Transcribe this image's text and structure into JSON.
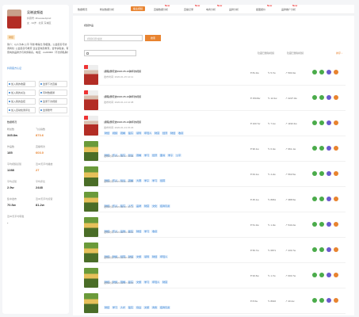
{
  "profile": {
    "name": "吴晓波频道",
    "id": "抖音号: Zhaoxiaobpind",
    "meta": "女  · 34岁 · 北京 东城区",
    "tag": "财经",
    "bio": "简介：以人为本,公平 平衡 唯得比 到极致。公益慈善与协调商化: 公益慈善与教育 企业咨询及教育。合作请私信，有意向的品牌方与商务联系。电话：xxx00000（不支持私聊）",
    "verified": "抖音官方认证"
  },
  "side_buttons": [
    "加入我的收藏",
    "监测下次直播",
    "加入我的关注",
    "同时数据通",
    "加入我的监控",
    "监测下次视频",
    "加入自动检测评论",
    "监测账号"
  ],
  "stats_title": "数据概况",
  "stats": [
    {
      "label": "粉丝数",
      "value": "345.8w",
      "orange": false
    },
    {
      "label": "飞瓜指数",
      "value": "873.6",
      "orange": true
    },
    {
      "label": "作品数",
      "value": "185",
      "orange": false
    },
    {
      "label": "直播场次",
      "value": "603.0",
      "orange": true
    },
    {
      "label": "平均视频点赞",
      "value": "1288",
      "orange": false
    },
    {
      "label": "近30天平均播放",
      "value": "27",
      "orange": true
    },
    {
      "label": "平均点赞",
      "value": "2.9w",
      "orange": false
    },
    {
      "label": "平均评论",
      "value": "2448",
      "orange": false
    },
    {
      "label": "集中发布",
      "value": "70.5w",
      "orange": false
    },
    {
      "label": "近30天平均点赞",
      "value": "81.2w",
      "orange": false
    },
    {
      "label": "近30天平均转发",
      "value": "-",
      "orange": false
    }
  ],
  "tabs": [
    {
      "label": "数据概况",
      "active": false,
      "new": false
    },
    {
      "label": "粉丝数据分析",
      "active": false,
      "new": false
    },
    {
      "label": "播主视频",
      "active": true,
      "new": false
    },
    {
      "label": "直播数据分析",
      "active": false,
      "new": true
    },
    {
      "label": "直播记录",
      "active": false,
      "new": true
    },
    {
      "label": "电商分析",
      "active": false,
      "new": true
    },
    {
      "label": "品牌分析",
      "active": false,
      "new": false
    },
    {
      "label": "星图报价",
      "active": false,
      "new": true
    },
    {
      "label": "品牌推广分析",
      "active": false,
      "new": true
    }
  ],
  "main": {
    "title": "视频作品",
    "search_placeholder": "视频标题/描述",
    "search_button": "搜索",
    "opt_a": "隐藏已删除视频",
    "opt_b": "隐藏已删除视频",
    "sort": "排序 ↓"
  },
  "videos": [
    {
      "title": "[课程]吴晓波2020-05-10跨年的视频",
      "date": "发布时间: 2020-01-15 12:11",
      "tags": [],
      "likes": "81.3w",
      "comments": "5.7w",
      "shares": "500.3w",
      "thumb": "red",
      "badge": true
    },
    {
      "title": "[课程]吴晓波2020-05-10跨年的视频",
      "date": "发布时间: 2020-01-14 12:38",
      "tags": [],
      "likes": "150.8w",
      "comments": "12.2w",
      "shares": "2227.3w",
      "thumb": "red",
      "badge": true
    },
    {
      "title": "[课程]吴晓波2020-05-10跨年的视频",
      "date": "发布时间: 2020-01-13 15:23",
      "tags": [
        "财经",
        "视频",
        "观看",
        "股东",
        "领导",
        "年轻人",
        "财富",
        "经济",
        "财经",
        "收货"
      ],
      "likes": "100.7w",
      "comments": "7.1w",
      "shares": "1193.3w",
      "thumb": "red",
      "badge": true
    },
    {
      "title": "",
      "date": "发布时间: 2020-01-12 13:35",
      "tags": [
        "财经",
        "乐人",
        "股东",
        "创业",
        "观看",
        "学习",
        "经济",
        "图书",
        "学子",
        "公平"
      ],
      "likes": "96.1w",
      "comments": "6.4w",
      "shares": "961.1w",
      "thumb": "green",
      "badge": false
    },
    {
      "title": "",
      "date": "发布时间: 2020-01-11 12:22",
      "tags": [
        "财经",
        "乐人",
        "创业",
        "观看",
        "大赛",
        "学子",
        "学习",
        "经营"
      ],
      "likes": "63.1w",
      "comments": "4.2w",
      "shares": "563.5w",
      "thumb": "green",
      "badge": false
    },
    {
      "title": "",
      "date": "发布时间: 2020-01-10 12:14",
      "tags": [
        "财经",
        "乐人",
        "股东",
        "人气",
        "品牌",
        "财富",
        "文化",
        "招商引资"
      ],
      "likes": "45.1w",
      "comments": "8961",
      "shares": "388.5w",
      "thumb": "green",
      "badge": false
    },
    {
      "title": "",
      "date": "发布时间: 2020-01-09 16:21",
      "tags": [
        "财经",
        "乐人",
        "品牌",
        "股东",
        "财经",
        "学习",
        "收货"
      ],
      "likes": "51.3w",
      "comments": "1.3w",
      "shares": "543.2w",
      "thumb": "green",
      "badge": false
    },
    {
      "title": "",
      "date": "发布时间: 2020-01-08 14:34",
      "tags": [
        "财经",
        "财务",
        "经营",
        "财经",
        "文旅",
        "领导",
        "财经",
        "年轻人"
      ],
      "likes": "56.7w",
      "comments": "6871",
      "shares": "433.7w",
      "thumb": "green",
      "badge": false
    },
    {
      "title": "",
      "date": "发布时间: 2020-01-07 13:30",
      "tags": [
        "财经",
        "财务",
        "观看",
        "股东",
        "文旅",
        "学习",
        "年轻人",
        "财富"
      ],
      "likes": "93.6w",
      "comments": "1.7w",
      "shares": "603.7w",
      "thumb": "green",
      "badge": false
    },
    {
      "title": "",
      "date": "",
      "tags": [
        "财经",
        "学习",
        "人才",
        "股东",
        "创业",
        "文旅",
        "商务",
        "招商引资"
      ],
      "likes": "8.6w",
      "comments": "8916",
      "shares": "40.4w",
      "thumb": "green",
      "badge": false
    }
  ],
  "action_colors": [
    "#4aab4a",
    "#4aab4a",
    "#6a5acd",
    "#e8832f"
  ]
}
